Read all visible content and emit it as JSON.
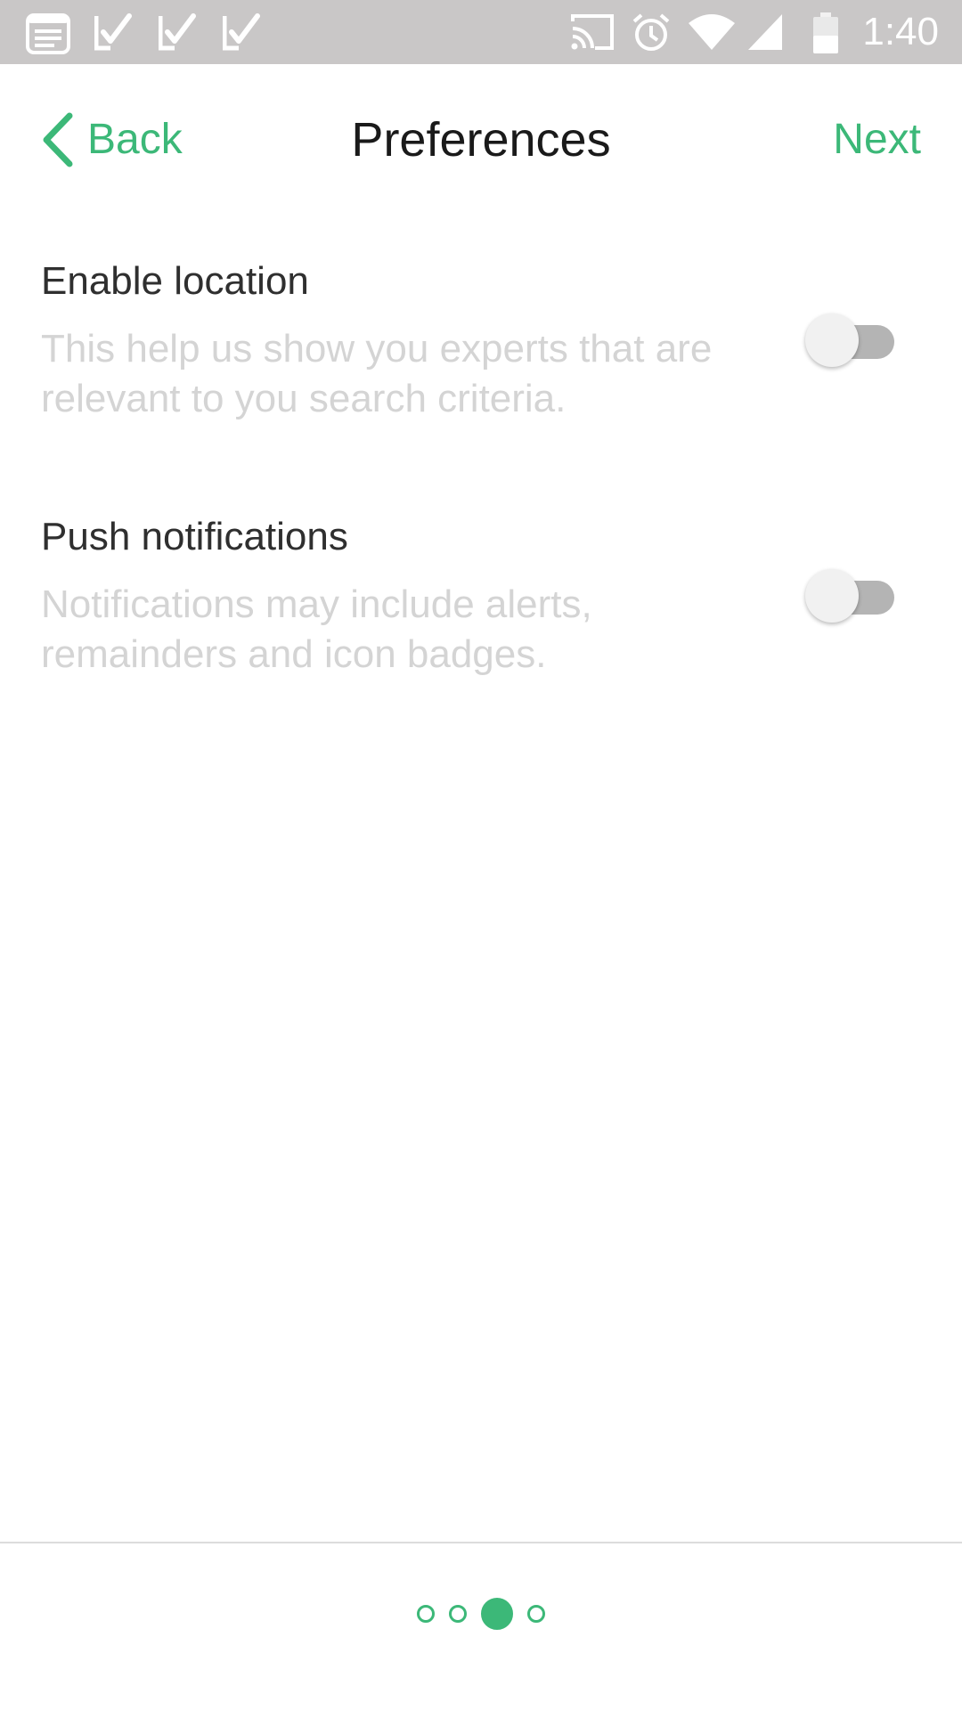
{
  "colors": {
    "accent": "#3cb878",
    "status_bar": "#c9c7c7"
  },
  "status_bar": {
    "time": "1:40",
    "left_icons": [
      "notes-icon",
      "check-icon",
      "check-icon",
      "check-icon"
    ],
    "right_icons": [
      "cast-icon",
      "alarm-icon",
      "wifi-icon",
      "signal-icon",
      "battery-icon"
    ]
  },
  "nav": {
    "back_label": "Back",
    "title": "Preferences",
    "next_label": "Next"
  },
  "settings": [
    {
      "title": "Enable location",
      "description": "This help us show you experts that are relevant to you search criteria.",
      "enabled": false
    },
    {
      "title": "Push notifications",
      "description": "Notifications may include alerts, remainders and icon badges.",
      "enabled": false
    }
  ],
  "pager": {
    "total": 4,
    "current": 3
  }
}
